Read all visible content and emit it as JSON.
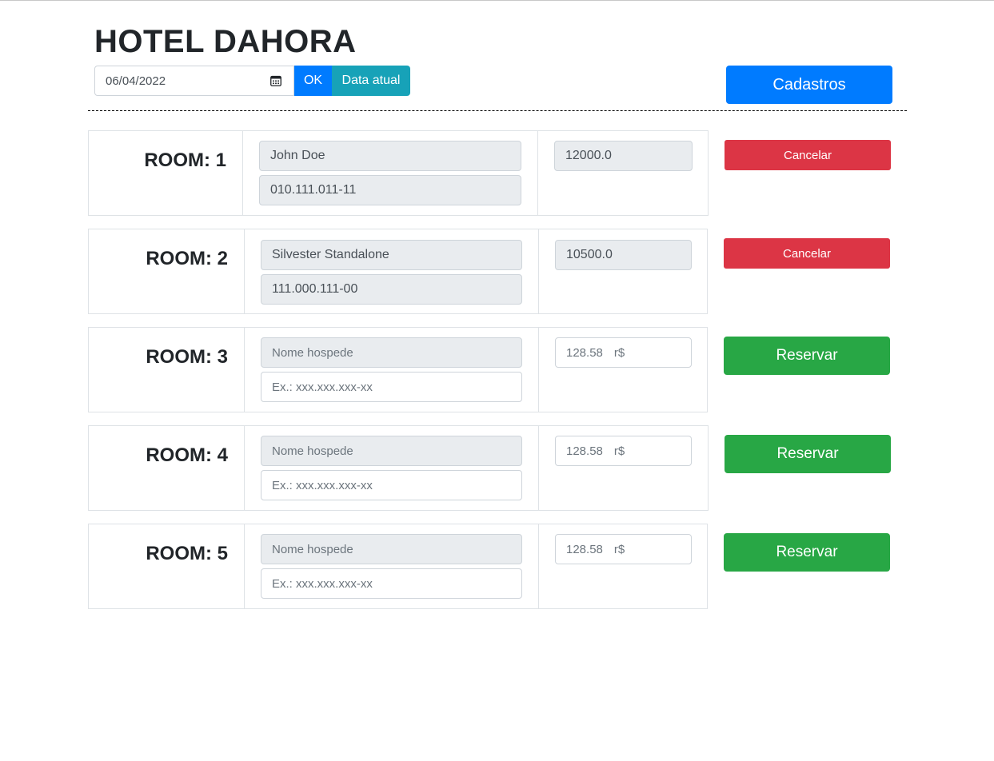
{
  "header": {
    "title": "HOTEL DAHORA",
    "date_value": "06/04/2022",
    "ok_label": "OK",
    "today_label": "Data atual",
    "cadastros_label": "Cadastros"
  },
  "colors": {
    "primary": "#007bff",
    "info": "#17a2b8",
    "danger": "#dc3545",
    "success": "#28a745"
  },
  "rooms": [
    {
      "label": "ROOM: 1",
      "guest_name": "John Doe",
      "guest_cpf": "010.111.011-11",
      "price": "12000.0",
      "action_label": "Cancelar"
    },
    {
      "label": "ROOM: 2",
      "guest_name": "Silvester Standalone",
      "guest_cpf": "111.000.111-00",
      "price": "10500.0",
      "action_label": "Cancelar"
    },
    {
      "label": "ROOM: 3",
      "guest_name_placeholder": "Nome hospede",
      "guest_cpf_placeholder": "Ex.:    xxx.xxx.xxx-xx",
      "price_placeholder": "128.58",
      "price_unit": "r$",
      "action_label": "Reservar"
    },
    {
      "label": "ROOM: 4",
      "guest_name_placeholder": "Nome hospede",
      "guest_cpf_placeholder": "Ex.:    xxx.xxx.xxx-xx",
      "price_placeholder": "128.58",
      "price_unit": "r$",
      "action_label": "Reservar"
    },
    {
      "label": "ROOM: 5",
      "guest_name_placeholder": "Nome hospede",
      "guest_cpf_placeholder": "Ex.:    xxx.xxx.xxx-xx",
      "price_placeholder": "128.58",
      "price_unit": "r$",
      "action_label": "Reservar"
    }
  ]
}
